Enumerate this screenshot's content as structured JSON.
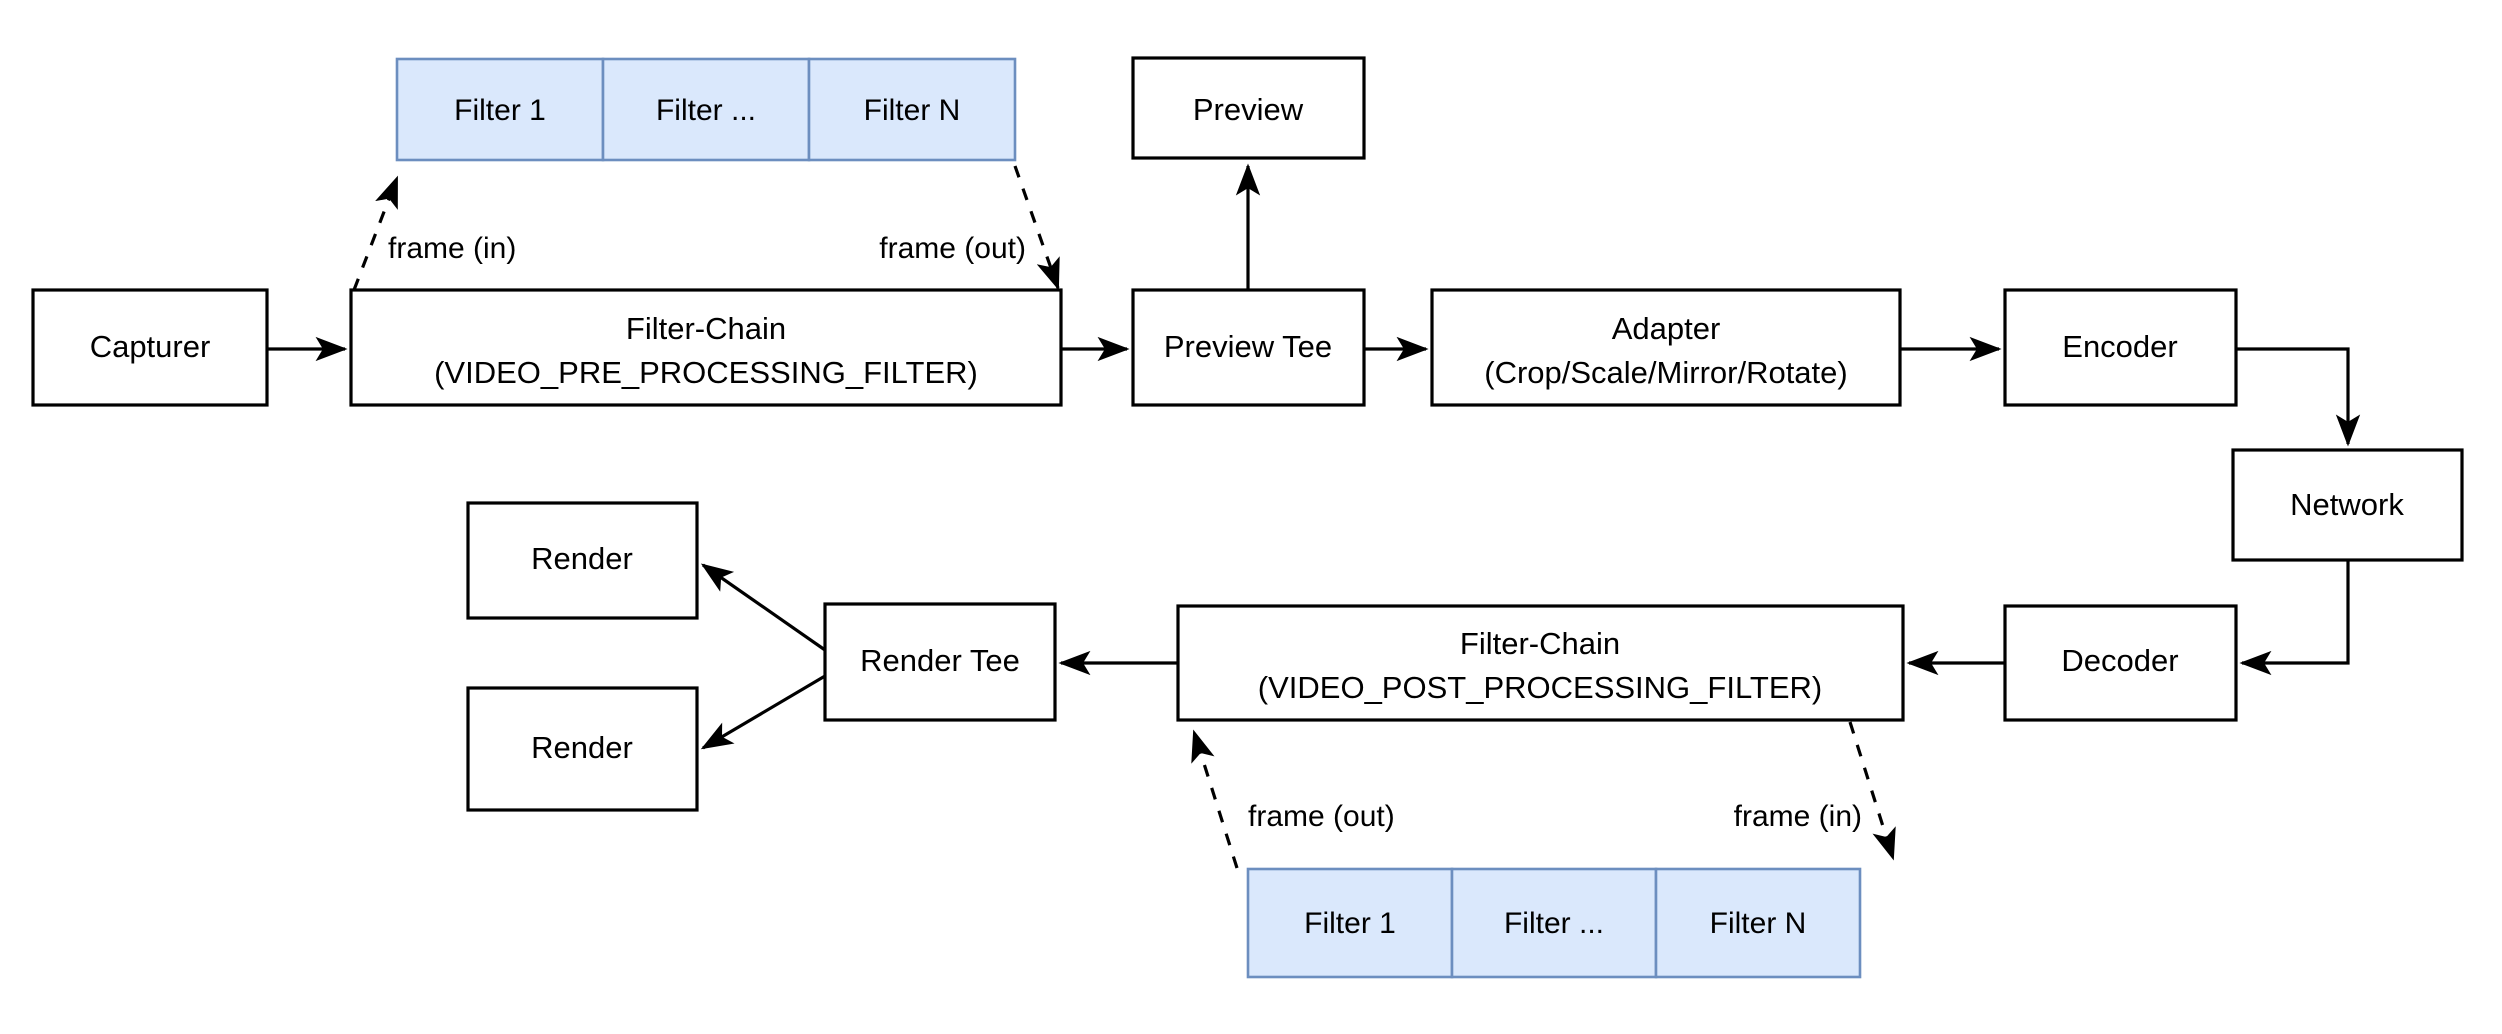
{
  "diagram": {
    "title": "Video Pipeline Filter Chain Diagram",
    "colors": {
      "filter_fill": "#dae8fc",
      "filter_stroke": "#6c8ebf",
      "node_fill": "#ffffff",
      "node_stroke": "#000000",
      "background": "#ffffff"
    },
    "nodes": {
      "capturer": "Capturer",
      "pre_filter_chain_line1": "Filter-Chain",
      "pre_filter_chain_line2": "(VIDEO_PRE_PROCESSING_FILTER)",
      "preview": "Preview",
      "preview_tee": "Preview Tee",
      "adapter_line1": "Adapter",
      "adapter_line2": "(Crop/Scale/Mirror/Rotate)",
      "encoder": "Encoder",
      "network": "Network",
      "decoder": "Decoder",
      "post_filter_chain_line1": "Filter-Chain",
      "post_filter_chain_line2": "(VIDEO_POST_PROCESSING_FILTER)",
      "render_tee": "Render Tee",
      "render_top": "Render",
      "render_bottom": "Render"
    },
    "top_filters": [
      {
        "label": "Filter 1"
      },
      {
        "label": "Filter ..."
      },
      {
        "label": "Filter N"
      }
    ],
    "bottom_filters": [
      {
        "label": "Filter 1"
      },
      {
        "label": "Filter ..."
      },
      {
        "label": "Filter N"
      }
    ],
    "edge_labels": {
      "top_frame_in": "frame (in)",
      "top_frame_out": "frame (out)",
      "bottom_frame_out": "frame (out)",
      "bottom_frame_in": "frame (in)"
    }
  }
}
